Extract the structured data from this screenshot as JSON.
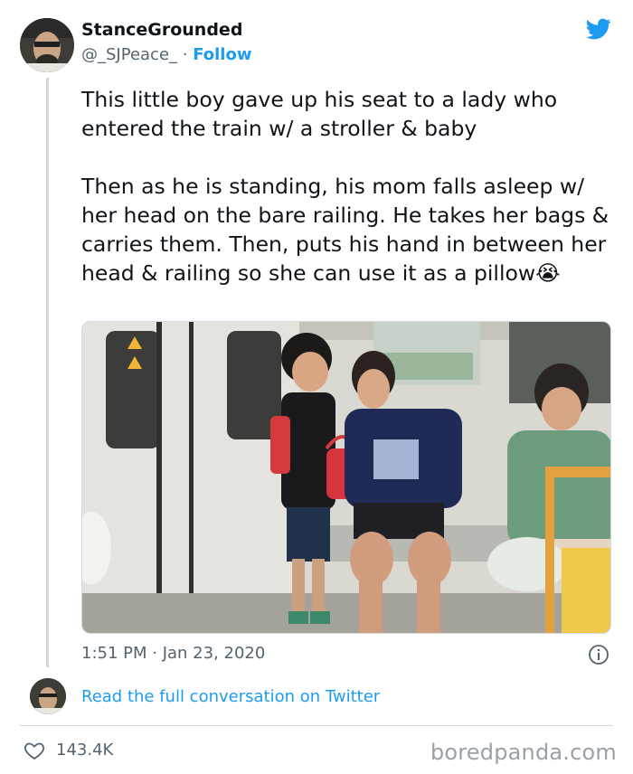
{
  "tweet": {
    "display_name": "StanceGrounded",
    "handle": "@_SJPeace_",
    "separator": " · ",
    "follow_label": "Follow",
    "text_p1": "This little boy gave up his seat to a lady who entered the train w/ a stroller & baby",
    "text_p2": "Then as he is standing, his mom falls asleep w/ her head on the bare railing. He takes her bags & carries them. Then, puts his hand in between her head & railing so she can use it as a pillow😭",
    "timestamp": "1:51 PM · Jan 23, 2020",
    "read_more": "Read the full conversation on Twitter",
    "likes": "143.4K"
  },
  "watermark": "boredpanda.com",
  "colors": {
    "accent": "#1d9bf0",
    "muted": "#536471",
    "text": "#0f1419"
  },
  "icons": {
    "brand": "twitter-bird-icon",
    "info": "info-icon",
    "like": "heart-icon"
  }
}
